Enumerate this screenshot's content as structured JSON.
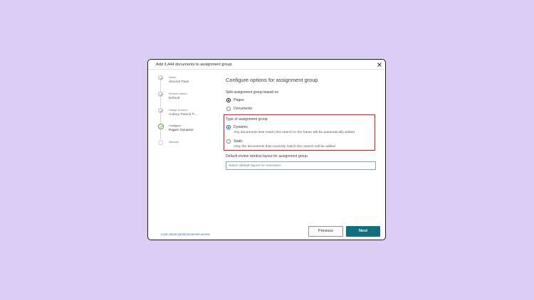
{
  "dialog": {
    "title": "Add 3,444 documents to assignment group"
  },
  "steps": [
    {
      "label": "Name",
      "value": "Second Pass",
      "state": "complete"
    },
    {
      "label": "Review criteria",
      "value": "Default",
      "state": "complete"
    },
    {
      "label": "Assign to users",
      "value": "Aubrey Patrick Tr...",
      "state": "complete"
    },
    {
      "label": "Configure",
      "value": "Pages: Dynamic",
      "state": "active"
    },
    {
      "label": "Allocate",
      "value": "",
      "state": "pending"
    }
  ],
  "main": {
    "heading": "Configure options for assignment group",
    "split": {
      "label": "Split assignment group based on",
      "options": [
        {
          "label": "Pages",
          "checked": true
        },
        {
          "label": "Documents",
          "checked": false
        }
      ]
    },
    "type": {
      "label": "Type of assignment group",
      "options": [
        {
          "label": "Dynamic",
          "description": "Any documents that match this search in the future will be automatically added",
          "checked": true
        },
        {
          "label": "Static",
          "description": "Only the documents that currently match this search will be added",
          "checked": false
        }
      ]
    },
    "layout": {
      "label": "Default review window layout for assignment group",
      "placeholder": "Select default layout for reviewers"
    }
  },
  "footer": {
    "link": "Learn about partial document access",
    "previous": "Previous",
    "next": "Next"
  },
  "colors": {
    "background": "#dccdf5",
    "accent": "#0f6f7c",
    "highlight": "#d21a1a",
    "step_complete": "#5e9a3c"
  },
  "icons": [
    "close-icon",
    "check-icon",
    "radio-icon"
  ]
}
